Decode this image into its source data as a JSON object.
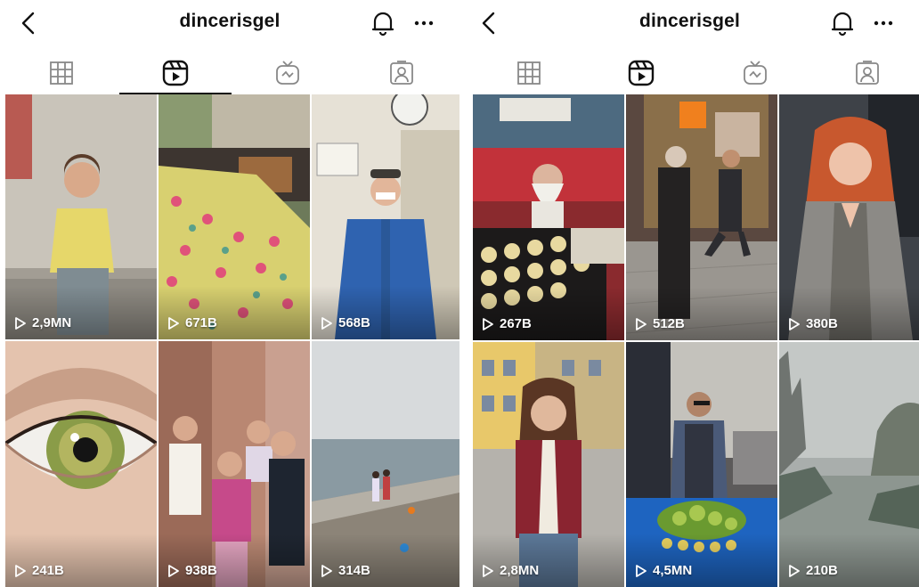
{
  "left": {
    "username": "dincerisgel",
    "tiles": [
      {
        "views": "2,9MN",
        "scene": "child-wall"
      },
      {
        "views": "671B",
        "scene": "blanket-sleeper"
      },
      {
        "views": "568B",
        "scene": "man-blue-coat"
      },
      {
        "views": "241B",
        "scene": "eye-closeup"
      },
      {
        "views": "938B",
        "scene": "kids-group"
      },
      {
        "views": "314B",
        "scene": "beach-kids"
      }
    ]
  },
  "right": {
    "username": "dincerisgel",
    "tiles": [
      {
        "views": "267B",
        "scene": "old-man-shop"
      },
      {
        "views": "512B",
        "scene": "street-men"
      },
      {
        "views": "380B",
        "scene": "redhead-woman"
      },
      {
        "views": "2,8MN",
        "scene": "girl-vest"
      },
      {
        "views": "4,5MN",
        "scene": "street-vendor"
      },
      {
        "views": "210B",
        "scene": "foggy-river"
      }
    ]
  },
  "tabs": [
    "posts-grid",
    "reels",
    "igtv",
    "tagged"
  ],
  "colors": {
    "text": "#111111",
    "background": "#ffffff",
    "views_text": "#ffffff"
  }
}
